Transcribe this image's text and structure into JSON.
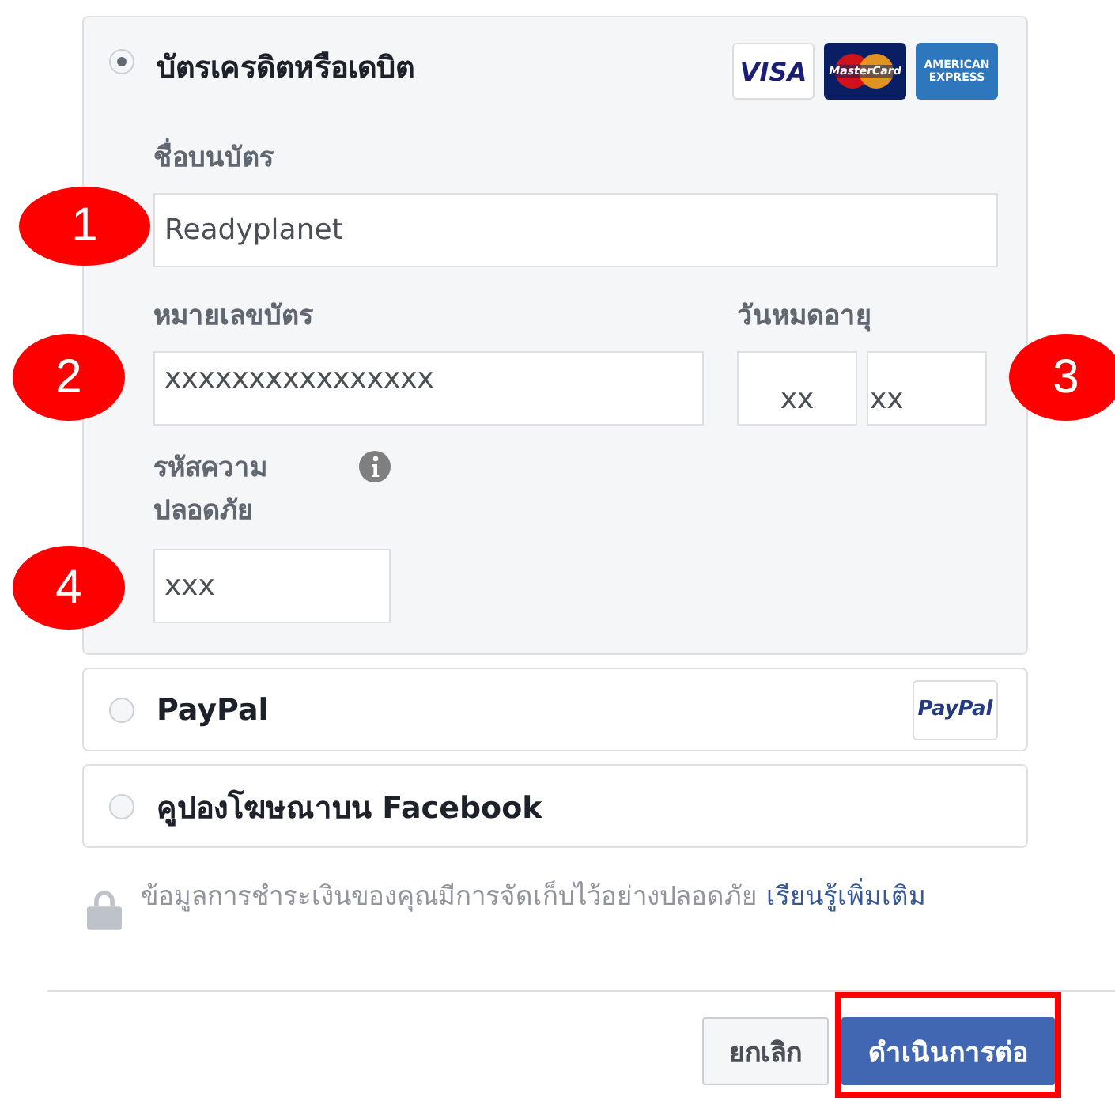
{
  "card_option": {
    "label": "บัตรเครดิตหรือเดบิต",
    "selected": true,
    "logos": [
      {
        "kind": "visa",
        "text": "VISA"
      },
      {
        "kind": "mastercard",
        "text": "MasterCard"
      },
      {
        "kind": "amex",
        "lines": [
          "AMERICAN",
          "EXPRESS"
        ]
      }
    ],
    "fields": [
      {
        "kind": "name",
        "label": "ชื่อบนบัตร",
        "value": "Readyplanet",
        "marker": "1"
      },
      {
        "kind": "number",
        "label": "หมายเลขบัตร",
        "value": "xxxxxxxxxxxxxxxx",
        "marker": "2"
      },
      {
        "kind": "expiry",
        "label": "วันหมดอายุ",
        "values": [
          "xx",
          "xx"
        ],
        "marker": "3"
      },
      {
        "kind": "cvv",
        "label_lines": [
          "รหัสความ",
          "ปลอดภัย"
        ],
        "value": "xxx",
        "info": true,
        "marker": "4"
      }
    ]
  },
  "other_options": [
    {
      "label": "PayPal",
      "selected": false,
      "logo": "PayPal"
    },
    {
      "label": "คูปองโฆษณาบน Facebook",
      "selected": false
    }
  ],
  "security_note": {
    "text": "ข้อมูลการชำระเงินของคุณมีการจัดเก็บไว้อย่างปลอดภัย",
    "link": "เรียนรู้เพิ่มเติม"
  },
  "buttons": [
    {
      "kind": "secondary",
      "label": "ยกเลิก",
      "highlighted": false
    },
    {
      "kind": "primary",
      "label": "ดำเนินการต่อ",
      "highlighted": true
    }
  ]
}
